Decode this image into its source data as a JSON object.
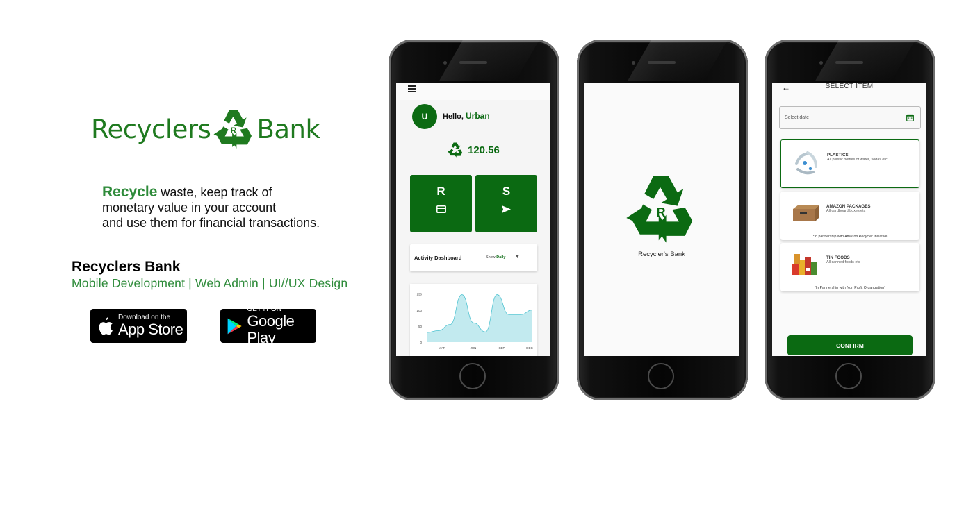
{
  "brand": {
    "logo_left": "Recyclers",
    "logo_mark_letter": "R",
    "logo_right": "Bank",
    "accent": "#1f7a1f",
    "dark_green": "#0b6a12"
  },
  "promo": {
    "highlight": "Recycle",
    "line1": " waste, keep track of",
    "line2": "monetary value in your account",
    "line3": "and use them for financial transactions.",
    "title": "Recyclers Bank",
    "subtitle": "Mobile Development | Web Admin | UI//UX Design",
    "app_store_small": "Download on the",
    "app_store_big": "App Store",
    "play_small": "GET IT ON",
    "play_big": "Google Play"
  },
  "screen1": {
    "avatar_letter": "U",
    "greeting": "Hello, ",
    "user_name": "Urban",
    "balance": "120.56",
    "tile_r": "R",
    "tile_s": "S",
    "dashboard_title": "Activity Dashboard",
    "show_label": "Show:",
    "show_value": "Daily",
    "chart_data": {
      "type": "area",
      "x": [
        "MAR",
        "JUN",
        "SEP",
        "DEC"
      ],
      "yticks": [
        0,
        50,
        100,
        150
      ],
      "ylim": [
        0,
        160
      ],
      "series": [
        {
          "values": [
            30,
            36,
            55,
            148,
            60,
            32,
            148,
            86,
            86,
            100
          ]
        }
      ],
      "color": "#4fc3d1"
    }
  },
  "screen2": {
    "splash_letter": "R",
    "app_name": "Recycler's Bank"
  },
  "screen3": {
    "title": "SELECT ITEM",
    "date_placeholder": "Select date",
    "items": [
      {
        "name": "PLASTICS",
        "desc": "All plastic bottles of water, sodas etc",
        "note": ""
      },
      {
        "name": "AMAZON PACKAGES",
        "desc": "All cardboard boxes etc",
        "note": "*In partnership with Amazon Recycler Initiative"
      },
      {
        "name": "TIN FOODS",
        "desc": "All canned foods etc",
        "note": "*In Partnership with Non Profit Organization*"
      }
    ],
    "confirm": "CONFIRM"
  },
  "icons": [
    "recycle-icon",
    "apple-icon",
    "play-icon",
    "menu-icon",
    "card-icon",
    "send-icon",
    "caret-down-icon",
    "back-arrow-icon",
    "calendar-icon"
  ]
}
